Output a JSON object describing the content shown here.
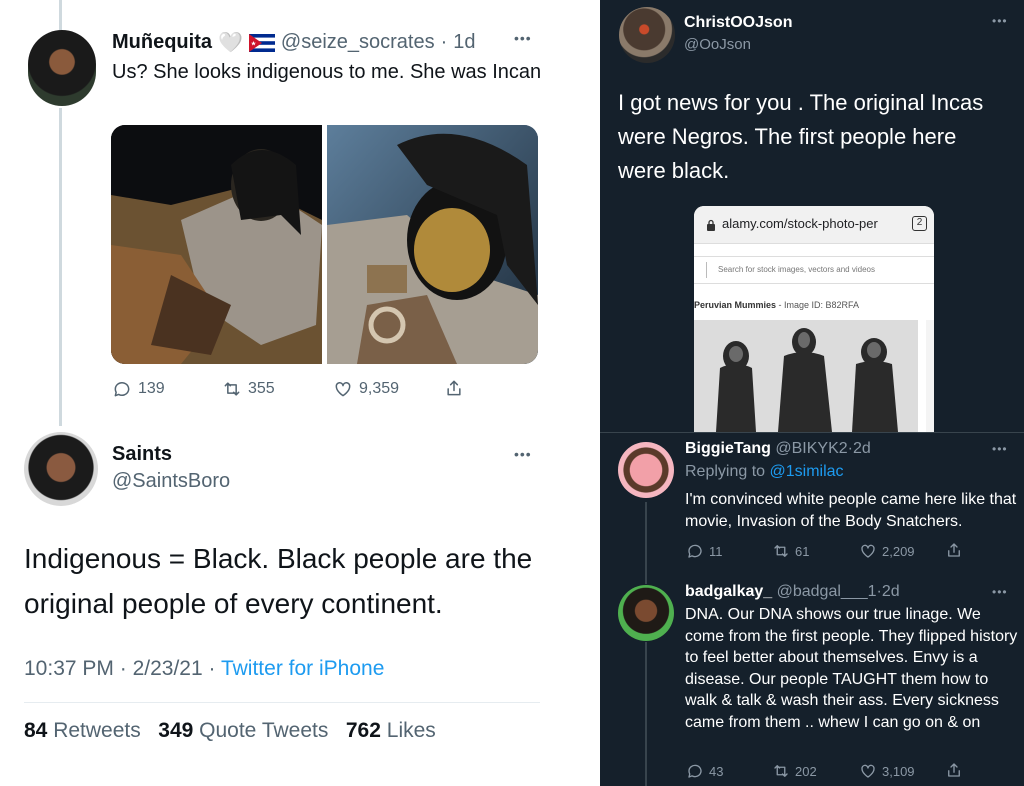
{
  "left": {
    "reply_tweet": {
      "name": "Muñequita",
      "emoji": "🤍",
      "handle": "@seize_socrates",
      "sep": "·",
      "time": "1d",
      "text": "Us? She looks indigenous to me. She was Incan",
      "stats": {
        "replies": "139",
        "retweets": "355",
        "likes": "9,359"
      }
    },
    "main_tweet": {
      "name": "Saints",
      "handle": "@SaintsBoro",
      "text": "Indigenous = Black. Black people are the original people of every continent.",
      "time": "10:37 PM",
      "sep1": "·",
      "date": "2/23/21",
      "sep2": "·",
      "source": "Twitter for iPhone",
      "retweets_count": "84",
      "retweets_label": "Retweets",
      "quotes_count": "349",
      "quotes_label": "Quote Tweets",
      "likes_count": "762",
      "likes_label": "Likes"
    }
  },
  "right_top": {
    "name": "ChristOOJson",
    "handle": "@OoJson",
    "text": "I got news for you . The original Incas were Negros. The first people here were black.",
    "browser": {
      "url": "alamy.com/stock-photo-per",
      "tabs": "2",
      "search_placeholder": "Search for stock images, vectors and videos",
      "caption_title": "Peruvian Mummies",
      "caption_id": " - Image ID: B82RFA"
    }
  },
  "right_bottom": {
    "reply1": {
      "name": "BiggieTang",
      "handle": "@BIKYK2",
      "sep": "·",
      "time": "2d",
      "replying_label": "Replying to",
      "replying_to": "@1similac",
      "text": "I'm convinced white people came here like that movie, Invasion of the Body Snatchers.",
      "stats": {
        "replies": "11",
        "retweets": "61",
        "likes": "2,209"
      }
    },
    "reply2": {
      "name": "badgalkay_",
      "handle": "@badgal___1",
      "sep": "·",
      "time": "2d",
      "text": "DNA. Our DNA shows our true linage. We come from the first people. They flipped history to feel better about themselves. Envy is a disease. Our people TAUGHT them how to walk & talk & wash their ass. Every sickness came from them .. whew I can go on & on",
      "stats": {
        "replies": "43",
        "retweets": "202",
        "likes": "3,109"
      }
    }
  },
  "colors": {
    "dark_bg": "#15202b",
    "twitter_blue": "#1d9bf0",
    "light_grey": "#536471",
    "dark_grey": "#8b98a5"
  },
  "icons": [
    "reply-icon",
    "retweet-icon",
    "like-icon",
    "share-icon",
    "more-icon",
    "cuba-flag-icon",
    "lock-icon"
  ]
}
